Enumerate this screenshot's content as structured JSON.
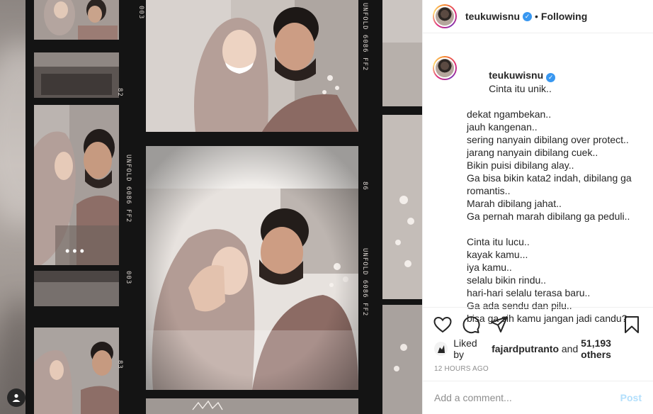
{
  "header": {
    "username": "teukuwisnu",
    "separator": "•",
    "follow_status": "Following"
  },
  "caption": {
    "username": "teukuwisnu",
    "lines": [
      "Cinta itu unik..",
      "dekat ngambekan..",
      "jauh kangenan..",
      "sering nanyain dibilang over protect..",
      "jarang nanyain dibilang cuek..",
      "Bikin puisi dibilang alay..",
      "Ga bisa bikin kata2 indah, dibilang ga",
      "romantis..",
      "Marah dibilang jahat..",
      "Ga pernah marah dibilang ga peduli..",
      "",
      "Cinta itu lucu..",
      "kayak kamu...",
      "iya kamu..",
      "selalu bikin rindu..",
      "hari-hari selalu terasa baru..",
      "Ga ada sendu dan pilu..",
      "bisa ga sih kamu jangan jadi candu?"
    ]
  },
  "likes": {
    "prefix": "Liked by",
    "user": "fajardputranto",
    "connector": "and",
    "others": "51,193 others"
  },
  "timestamp": "12 HOURS AGO",
  "comment": {
    "placeholder": "Add a comment...",
    "post_label": "Post"
  },
  "film_strip": {
    "left_text_1": "003",
    "left_text_2": "82",
    "left_text_3": "UNFOLD 6086 FF2",
    "left_text_4": "003",
    "left_text_5": "83",
    "right_text_1": "UNFOLD 6086 FF2",
    "right_text_2": "86",
    "right_text_3": "UNFOLD 6086 FF2"
  },
  "icons": {
    "like": "heart-icon",
    "comment": "comment-icon",
    "share": "share-icon",
    "save": "bookmark-icon"
  },
  "colors": {
    "verified": "#3897f0",
    "post_button": "#b2dffc",
    "timestamp": "#8e8e8e"
  }
}
